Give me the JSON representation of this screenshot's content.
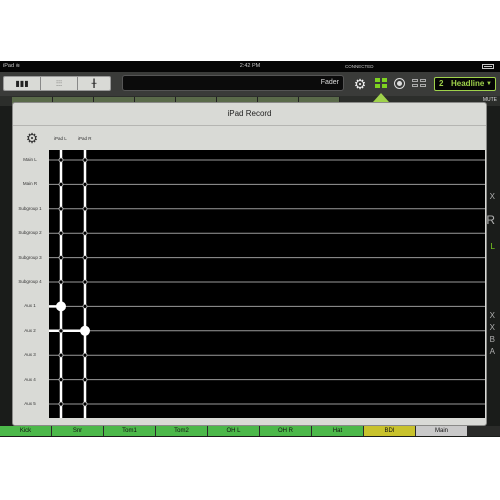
{
  "status_bar": {
    "device": "iPad",
    "time": "2:42 PM",
    "connection": "CONNECTED"
  },
  "toolbar": {
    "fader_label": "Fader",
    "scene": {
      "number": "2",
      "name": "Headline",
      "arrow": "▼"
    }
  },
  "side_labels": {
    "mute": "MUTE",
    "x": "X",
    "r": "R",
    "l": "L",
    "letters": [
      "X",
      "X",
      "B",
      "A"
    ]
  },
  "popup": {
    "title": "iPad Record",
    "columns": [
      "iPad L",
      "iPad R"
    ],
    "rows": [
      "Main L",
      "Main R",
      "Subgroup 1",
      "Subgroup 2",
      "Subgroup 3",
      "Subgroup 4",
      "Aux 1",
      "Aux 2",
      "Aux 3",
      "Aux 4",
      "Aux 5"
    ],
    "routing": {
      "iPad L": "Aux 1",
      "iPad R": "Aux 2"
    }
  },
  "channels": [
    {
      "label": "Kick",
      "color": "#4cb84a"
    },
    {
      "label": "Snr",
      "color": "#4cb84a"
    },
    {
      "label": "Tom1",
      "color": "#4cb84a"
    },
    {
      "label": "Tom2",
      "color": "#4cb84a"
    },
    {
      "label": "OH L",
      "color": "#4cb84a"
    },
    {
      "label": "OH R",
      "color": "#4cb84a"
    },
    {
      "label": "Hat",
      "color": "#4cb84a"
    },
    {
      "label": "BDI",
      "color": "#c8c22c"
    },
    {
      "label": "Main",
      "color": "#c9c9c9"
    }
  ],
  "colors": {
    "accent": "#9fd24b",
    "channel_green": "#4cb84a",
    "channel_yellow": "#c8c22c",
    "popup_bg": "#d9dad6",
    "matrix_bg": "#000000"
  }
}
